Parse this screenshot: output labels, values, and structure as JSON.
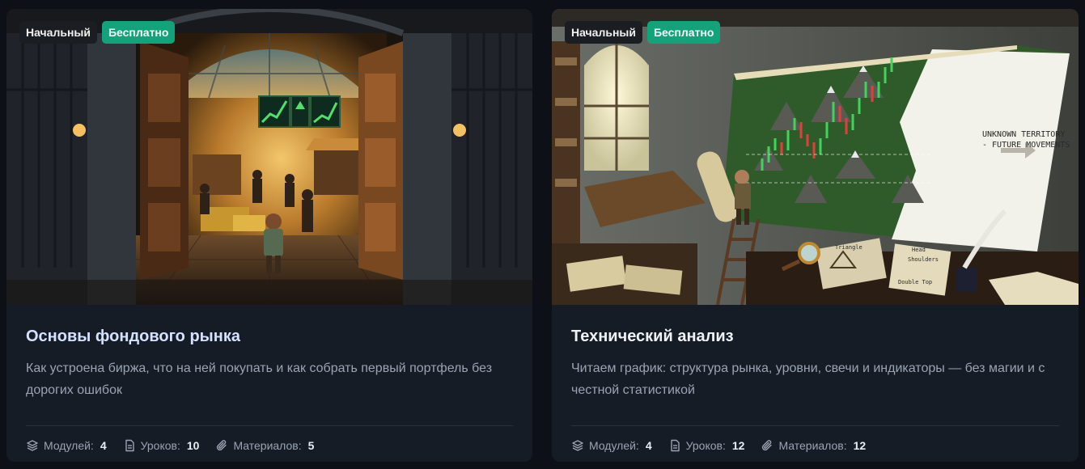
{
  "courses": [
    {
      "level": "Начальный",
      "price": "Бесплатно",
      "title": "Основы фондового рынка",
      "description": "Как устроена биржа, что на ней покупать и как собрать первый портфель без дорогих ошибок",
      "modules_label": "Модулей:",
      "modules": "4",
      "lessons_label": "Уроков:",
      "lessons": "10",
      "materials_label": "Материалов:",
      "materials": "5",
      "image": "pixel-art-stock-exchange-gate"
    },
    {
      "level": "Начальный",
      "price": "Бесплатно",
      "title": "Технический анализ",
      "description": "Читаем график: структура рынка, уровни, свечи и индикаторы — без магии и с честной статистикой",
      "modules_label": "Модулей:",
      "modules": "4",
      "lessons_label": "Уроков:",
      "lessons": "12",
      "materials_label": "Материалов:",
      "materials": "12",
      "image": "pixel-art-chart-map",
      "map_text": [
        "UNKNOWN TERRITORY",
        "- FUTURE MOVEMENTS",
        "Triangle",
        "Head",
        "Shoulders",
        "Double Top"
      ]
    }
  ],
  "colors": {
    "background": "#0d1117",
    "card": "#161c25",
    "badge_free": "#13a37a",
    "badge_level": "#1a1d22"
  }
}
